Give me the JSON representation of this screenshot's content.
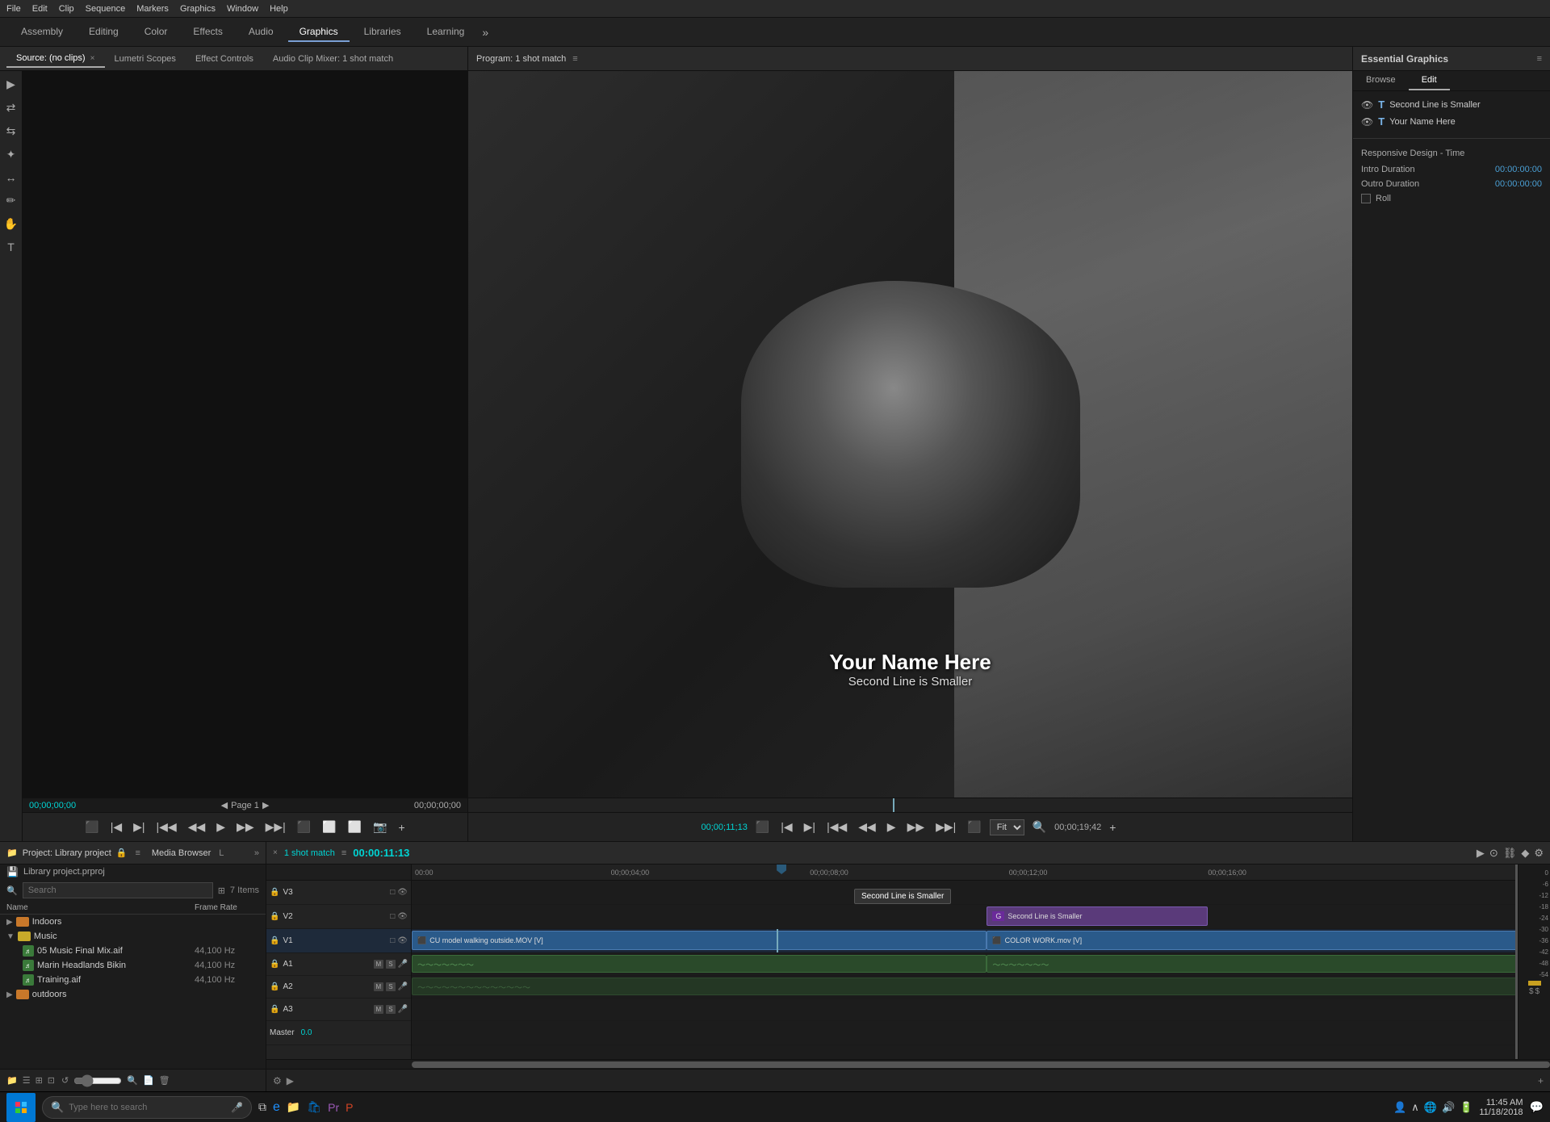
{
  "menubar": {
    "items": [
      "File",
      "Edit",
      "Clip",
      "Sequence",
      "Markers",
      "Graphics",
      "Window",
      "Help"
    ]
  },
  "workspace_tabs": {
    "tabs": [
      "Assembly",
      "Editing",
      "Color",
      "Effects",
      "Audio",
      "Graphics",
      "Libraries",
      "Learning"
    ],
    "active": "Graphics",
    "more_label": "»"
  },
  "left_panel": {
    "tabs": [
      "Source: (no clips)",
      "Lumetri Scopes",
      "Effect Controls",
      "Audio Clip Mixer: 1 shot match"
    ],
    "active_tab": "Source: (no clips)",
    "time_left": "00;00;00;00",
    "time_right": "00;00;00;00",
    "page": "Page 1"
  },
  "source_tools": [
    "▶",
    "⇄",
    "⇆",
    "✦",
    "↔",
    "✏",
    "✋",
    "T"
  ],
  "program_monitor": {
    "title": "Program: 1 shot match",
    "time_current": "00;00;11;13",
    "time_total": "00;00;19;42",
    "fit_label": "Fit",
    "overlay_name": "Your Name Here",
    "overlay_subtitle": "Second Line is Smaller"
  },
  "essential_graphics": {
    "title": "Essential Graphics",
    "tabs": [
      "Browse",
      "Edit"
    ],
    "active_tab": "Edit",
    "layers": [
      {
        "name": "Second Line is Smaller",
        "type": "T"
      },
      {
        "name": "Your Name Here",
        "type": "T"
      }
    ],
    "responsive_design_title": "Responsive Design - Time",
    "intro_duration_label": "Intro Duration",
    "intro_duration_value": "00:00:00:00",
    "outro_duration_label": "Outro Duration",
    "outro_duration_value": "00:00:00:00",
    "roll_label": "Roll"
  },
  "project_panel": {
    "title": "Project: Library project",
    "items_count": "7 Items",
    "search_placeholder": "Search",
    "col_name": "Name",
    "col_framerate": "Frame Rate",
    "folders": [
      {
        "name": "Indoors",
        "color": "orange",
        "expanded": false
      },
      {
        "name": "Music",
        "color": "yellow",
        "expanded": true
      },
      {
        "name": "outdoors",
        "color": "orange",
        "expanded": false
      }
    ],
    "files": [
      {
        "name": "05 Music Final Mix.aif",
        "rate": "44,100 Hz"
      },
      {
        "name": "Marin Headlands Bikin",
        "rate": "44,100 Hz"
      },
      {
        "name": "Training.aif",
        "rate": "44,100 Hz"
      }
    ],
    "project_file": "Library project.prproj"
  },
  "timeline": {
    "name": "1 shot match",
    "time_display": "00:00:11:13",
    "timecodes": [
      "00:00",
      "00;00;04;00",
      "00;00;08;00",
      "00;00;12;00",
      "00;00;16;00"
    ],
    "tracks": {
      "v3_label": "V3",
      "v2_label": "V2",
      "v1_label": "V1",
      "a1_label": "A1",
      "a2_label": "A2",
      "a3_label": "A3",
      "master_label": "Master",
      "master_value": "0.0"
    },
    "clips": {
      "v2_clip": "Second Line is Smaller",
      "v1_clip1": "CU model walking outside.MOV [V]",
      "v1_clip2": "COLOR WORK.mov [V]"
    }
  },
  "taskbar": {
    "search_placeholder": "Type here to search",
    "time": "11:45 AM",
    "date": "11/18/2018"
  }
}
